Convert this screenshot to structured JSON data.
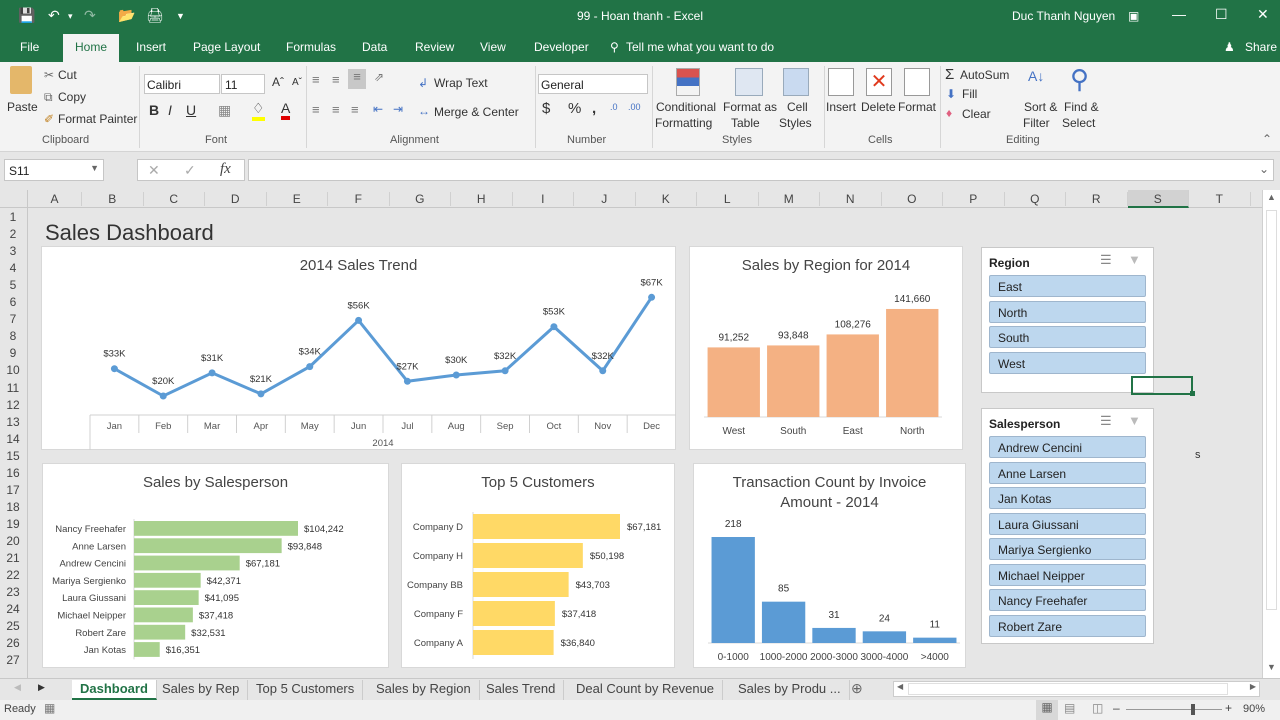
{
  "window": {
    "title": "99 - Hoan thanh - Excel",
    "user": "Duc Thanh Nguyen",
    "accent": "#217346"
  },
  "ribbon_tabs": [
    "File",
    "Home",
    "Insert",
    "Page Layout",
    "Formulas",
    "Data",
    "Review",
    "View",
    "Developer"
  ],
  "tell_me": "Tell me what you want to do",
  "share": "Share",
  "clipboard": {
    "paste": "Paste",
    "cut": "Cut",
    "copy": "Copy",
    "format_painter": "Format Painter",
    "label": "Clipboard"
  },
  "font": {
    "name": "Calibri",
    "size": "11",
    "label": "Font"
  },
  "alignment": {
    "wrap": "Wrap Text",
    "merge": "Merge & Center",
    "label": "Alignment"
  },
  "number": {
    "format": "General",
    "label": "Number"
  },
  "styles": {
    "conditional": "Conditional",
    "formatting": "Formatting",
    "format_as": "Format as",
    "table": "Table",
    "cell": "Cell",
    "cell_styles": "Styles",
    "label": "Styles"
  },
  "cells": {
    "insert": "Insert",
    "delete": "Delete",
    "format": "Format",
    "label": "Cells"
  },
  "editing": {
    "autosum": "AutoSum",
    "fill": "Fill",
    "clear": "Clear",
    "sort": "Sort &",
    "filter": "Filter",
    "find": "Find &",
    "select": "Select",
    "label": "Editing"
  },
  "formula_bar": {
    "name_box": "S11",
    "fx": "fx",
    "value": ""
  },
  "columns": [
    "A",
    "B",
    "C",
    "D",
    "E",
    "F",
    "G",
    "H",
    "I",
    "J",
    "K",
    "L",
    "M",
    "N",
    "O",
    "P",
    "Q",
    "R",
    "S",
    "T"
  ],
  "selected_column": "S",
  "rows": [
    "1",
    "2",
    "3",
    "4",
    "5",
    "6",
    "7",
    "8",
    "9",
    "10",
    "11",
    "12",
    "13",
    "14",
    "15",
    "16",
    "17",
    "18",
    "19",
    "20",
    "21",
    "22",
    "23",
    "24",
    "25",
    "26",
    "27"
  ],
  "sheet_title": "Sales Dashboard",
  "stray_cell_text": "s",
  "chart_data": [
    {
      "type": "line",
      "title": "2014 Sales Trend",
      "categories": [
        "Jan",
        "Feb",
        "Mar",
        "Apr",
        "May",
        "Jun",
        "Jul",
        "Aug",
        "Sep",
        "Oct",
        "Nov",
        "Dec"
      ],
      "values": [
        33,
        20,
        31,
        21,
        34,
        56,
        27,
        30,
        32,
        53,
        32,
        67
      ],
      "labels": [
        "$33K",
        "$20K",
        "$31K",
        "$21K",
        "$34K",
        "$56K",
        "$27K",
        "$30K",
        "$32K",
        "$53K",
        "$32K",
        "$67K"
      ],
      "xgroup": "2014",
      "color": "#5b9bd5"
    },
    {
      "type": "bar",
      "title": "Sales by Region for 2014",
      "categories": [
        "West",
        "South",
        "East",
        "North"
      ],
      "values": [
        91252,
        93848,
        108276,
        141660
      ],
      "labels": [
        "91,252",
        "93,848",
        "108,276",
        "141,660"
      ],
      "color": "#f4b183"
    },
    {
      "type": "bar",
      "orientation": "horizontal",
      "title": "Sales by Salesperson",
      "categories": [
        "Nancy Freehafer",
        "Anne Larsen",
        "Andrew Cencini",
        "Mariya Sergienko",
        "Laura Giussani",
        "Michael Neipper",
        "Robert Zare",
        "Jan Kotas"
      ],
      "values": [
        104242,
        93848,
        67181,
        42371,
        41095,
        37418,
        32531,
        16351
      ],
      "labels": [
        "$104,242",
        "$93,848",
        "$67,181",
        "$42,371",
        "$41,095",
        "$37,418",
        "$32,531",
        "$16,351"
      ],
      "color": "#a9d18e"
    },
    {
      "type": "bar",
      "orientation": "horizontal",
      "title": "Top 5 Customers",
      "categories": [
        "Company D",
        "Company H",
        "Company BB",
        "Company F",
        "Company A"
      ],
      "values": [
        67181,
        50198,
        43703,
        37418,
        36840
      ],
      "labels": [
        "$67,181",
        "$50,198",
        "$43,703",
        "$37,418",
        "$36,840"
      ],
      "color": "#ffd966"
    },
    {
      "type": "bar",
      "title": "Transaction Count by Invoice Amount - 2014",
      "title_lines": [
        "Transaction Count by Invoice",
        "Amount - 2014"
      ],
      "categories": [
        "0-1000",
        "1000-2000",
        "2000-3000",
        "3000-4000",
        ">4000"
      ],
      "values": [
        218,
        85,
        31,
        24,
        11
      ],
      "labels": [
        "218",
        "85",
        "31",
        "24",
        "11"
      ],
      "color": "#5b9bd5"
    }
  ],
  "slicers": {
    "region": {
      "title": "Region",
      "items": [
        "East",
        "North",
        "South",
        "West"
      ]
    },
    "salesperson": {
      "title": "Salesperson",
      "items": [
        "Andrew Cencini",
        "Anne Larsen",
        "Jan Kotas",
        "Laura Giussani",
        "Mariya Sergienko",
        "Michael Neipper",
        "Nancy Freehafer",
        "Robert Zare"
      ]
    }
  },
  "sheet_tabs": [
    "Dashboard",
    "Sales by Rep",
    "Top 5 Customers",
    "Sales by Region",
    "Sales Trend",
    "Deal Count by Revenue",
    "Sales by Produ ..."
  ],
  "active_sheet": "Dashboard",
  "status": {
    "ready": "Ready",
    "zoom": "90%",
    "zoom_value": 90
  }
}
